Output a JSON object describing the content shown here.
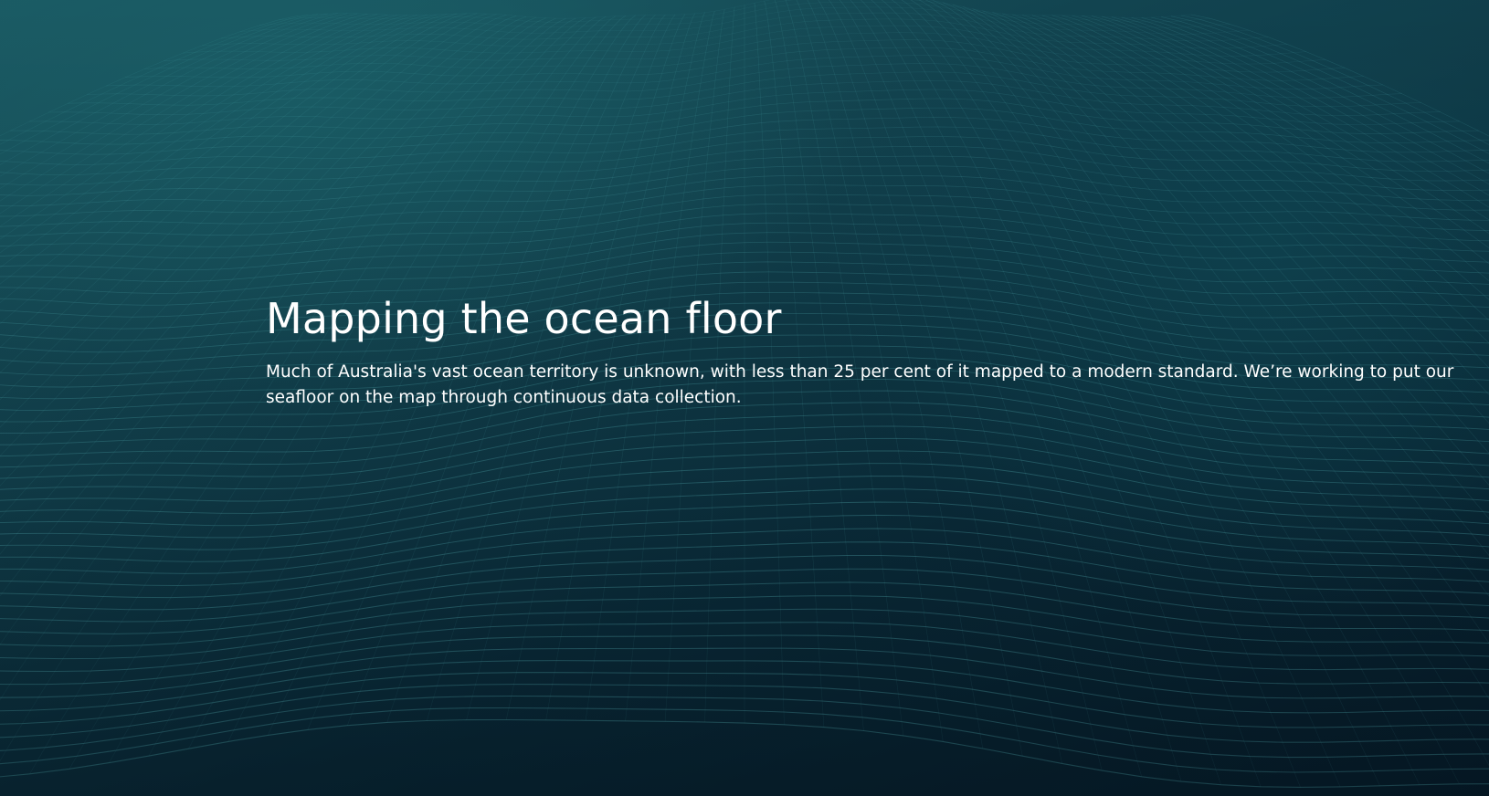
{
  "hero": {
    "title": "Mapping the ocean floor",
    "description": "Much of Australia's vast ocean territory is unknown, with less than 25 per cent of it mapped to a modern standard. We’re working to put our seafloor on the map through continuous data collection.",
    "background": "seafloor-wireframe-mesh"
  },
  "colors": {
    "background_dark": "#061a27",
    "background_teal": "#1b5a63",
    "mesh_line": "#5fc4c8",
    "text": "#ffffff"
  }
}
